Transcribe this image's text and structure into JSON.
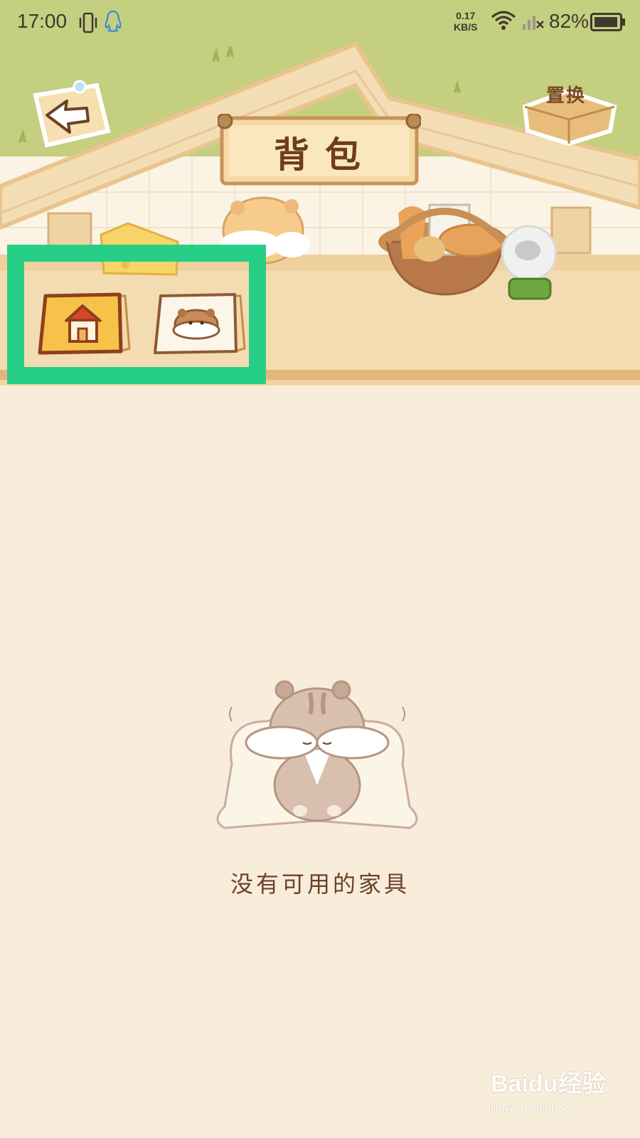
{
  "status_bar": {
    "time": "17:00",
    "net_speed_value": "0.17",
    "net_speed_unit": "KB/S",
    "battery": "82%"
  },
  "header": {
    "title": "背包",
    "swap_label": "置换"
  },
  "tabs": [
    {
      "icon": "house-icon",
      "selected": true
    },
    {
      "icon": "hamster-icon",
      "selected": false
    }
  ],
  "empty_state": {
    "message": "没有可用的家具"
  },
  "watermark": {
    "main": "Baidu经验",
    "sub": "jingyan.baidu.com"
  },
  "colors": {
    "highlight": "#27cf86",
    "background": "#f8ecdb",
    "grass": "#c4cf80",
    "wood": "#f2d9ae",
    "text_brown": "#6d4128"
  }
}
